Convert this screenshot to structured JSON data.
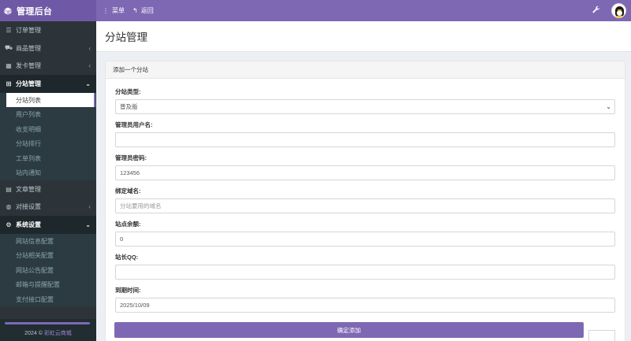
{
  "header": {
    "brand_icon": "cube-icon",
    "brand_title": "管理后台",
    "menu_label": "菜单",
    "back_label": "返回",
    "settings_icon": "wrench-icon",
    "avatar_icon": "penguin-avatar"
  },
  "sidebar": {
    "items": [
      {
        "label": "订单管理",
        "icon": "list-icon"
      },
      {
        "label": "商品管理",
        "icon": "cart-icon",
        "chevron": "‹"
      },
      {
        "label": "发卡管理",
        "icon": "grid-icon",
        "chevron": "‹"
      },
      {
        "label": "分站管理",
        "icon": "sitemap-icon",
        "chevron": "⌄"
      },
      {
        "label": "文章管理",
        "icon": "book-icon"
      },
      {
        "label": "对接设置",
        "icon": "globe-icon",
        "chevron": "‹"
      },
      {
        "label": "系统设置",
        "icon": "gear-icon",
        "chevron": "⌄"
      }
    ],
    "substation_sub": [
      "分站列表",
      "用户列表",
      "收支明细",
      "分站排行",
      "工单列表",
      "站内通知"
    ],
    "system_sub": [
      "网站信息配置",
      "分站相关配置",
      "网站公告配置",
      "邮箱与提醒配置",
      "支付接口配置"
    ],
    "footer_year": "2024 ©",
    "footer_link": "彩虹云商城"
  },
  "page": {
    "title": "分站管理",
    "panel_title": "添加一个分站",
    "fields": {
      "type_label": "分站类型:",
      "type_value": "普及版",
      "username_label": "管理员用户名:",
      "username_value": "",
      "password_label": "管理员密码:",
      "password_value": "123456",
      "domain_label": "绑定域名:",
      "domain_placeholder": "分站要用的域名",
      "balance_label": "站点余额:",
      "balance_value": "0",
      "qq_label": "站长QQ:",
      "qq_value": "",
      "expire_label": "到期时间:",
      "expire_value": "2025/10/09"
    },
    "submit_label": "确定添加"
  },
  "colors": {
    "accent": "#7f68b3",
    "sidebar_bg": "#2c343a"
  }
}
